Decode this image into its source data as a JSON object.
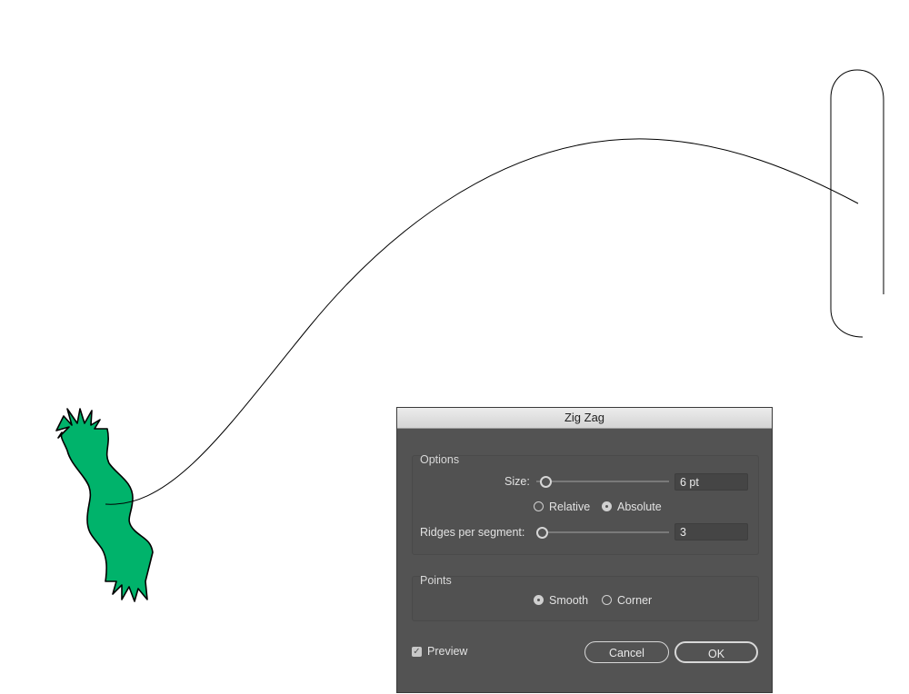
{
  "canvas": {
    "shape_fill": "#00b36b",
    "stroke": "#000000"
  },
  "dialog": {
    "title": "Zig Zag",
    "options": {
      "label": "Options",
      "size_label": "Size:",
      "size_value": "6 pt",
      "size_slider_fraction": 0.02,
      "relative_label": "Relative",
      "absolute_label": "Absolute",
      "selected_mode": "Absolute",
      "ridges_label": "Ridges per segment:",
      "ridges_value": "3",
      "ridges_slider_fraction": 0.02
    },
    "points": {
      "label": "Points",
      "smooth_label": "Smooth",
      "corner_label": "Corner",
      "selected": "Smooth"
    },
    "preview_label": "Preview",
    "preview_checked": true,
    "check_glyph": "✓",
    "cancel_label": "Cancel",
    "ok_label": "OK"
  }
}
